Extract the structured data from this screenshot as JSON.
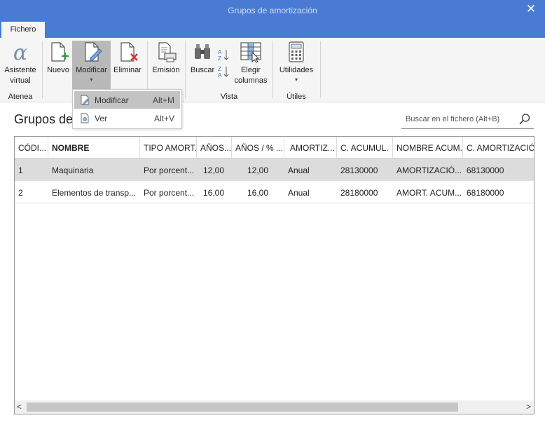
{
  "window": {
    "title": "Grupos de amortización",
    "close": "✕"
  },
  "tabs": [
    {
      "label": "Fichero"
    }
  ],
  "ribbon": {
    "asistente": {
      "line1": "Asistente",
      "line2": "virtual"
    },
    "nuevo": "Nuevo",
    "modificar": "Modificar",
    "eliminar": "Eliminar",
    "emision": "Emisión",
    "buscar": "Buscar",
    "elegir": {
      "line1": "Elegir",
      "line2": "columnas"
    },
    "utilidades": "Utilidades",
    "groups": {
      "atenea": "Atenea",
      "vista": "Vista",
      "utiles": "Útiles"
    }
  },
  "dropdown": {
    "items": [
      {
        "label": "Modificar",
        "shortcut": "Alt+M"
      },
      {
        "label": "Ver",
        "shortcut": "Alt+V"
      }
    ]
  },
  "page": {
    "title": "Grupos de"
  },
  "search": {
    "placeholder": "Buscar en el fichero (Alt+B)"
  },
  "table": {
    "headers": [
      "CÓDI...",
      "NOMBRE",
      "TIPO AMORT.",
      "AÑOS...",
      "AÑOS / % ...",
      "AMORTIZ...",
      "C. ACUMUL.",
      "NOMBRE ACUM.",
      "C. AMORTIZACIÓN"
    ],
    "rows": [
      [
        "1",
        "Maquinaria",
        "Por porcent...",
        "12,00",
        "12,00",
        "Anual",
        "28130000",
        "AMORTIZACIÓ...",
        "68130000"
      ],
      [
        "2",
        "Elementos de transp...",
        "Por porcent...",
        "16,00",
        "16,00",
        "Anual",
        "28180000",
        "AMORT. ACUM...",
        "68180000"
      ]
    ]
  },
  "scroll": {
    "left": "<",
    "right": ">"
  },
  "colors": {
    "titlebar": "#4a7bd4",
    "ribbon": "#f5f5f5",
    "selected_row": "#dcdcdc",
    "accent_green": "#2ea043",
    "accent_red": "#d9342b"
  }
}
